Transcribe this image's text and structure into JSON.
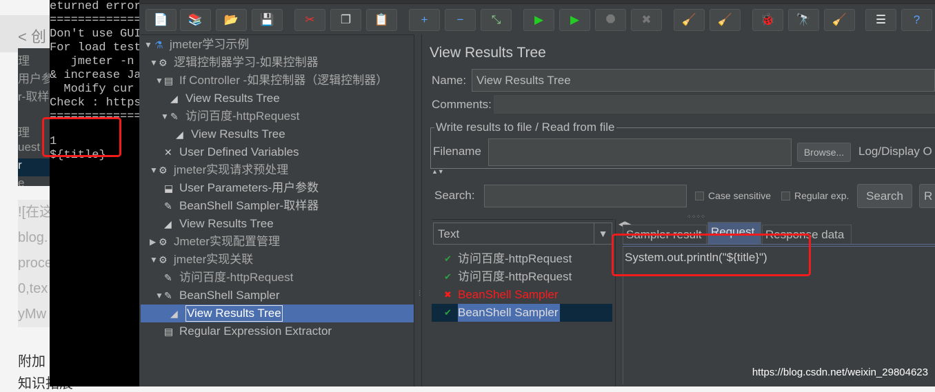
{
  "blog": {
    "back_label": "< 创",
    "shot_lines": [
      "理",
      "用户参",
      "r-取样",
      "",
      "理",
      "uest",
      "r",
      "e"
    ],
    "code_lines": [
      "![在这",
      "blog.",
      "proce",
      "0,tex",
      "yMw"
    ],
    "heading": "附加",
    "next_heading": "知识拓展"
  },
  "terminal": {
    "lines": [
      "eturned error",
      "=============",
      "Don't use GUI",
      "For load test",
      "   jmeter -n ",
      "& increase Ja",
      "  Modify cur",
      "Check : https",
      "=============",
      "1",
      "${title}"
    ]
  },
  "toolbar": {
    "buttons": [
      {
        "name": "new",
        "glyph": "📄",
        "color": "#eee"
      },
      {
        "name": "templates",
        "glyph": "📚",
        "color": "#3a3"
      },
      {
        "name": "open",
        "glyph": "📂",
        "color": "#e8a33a"
      },
      {
        "name": "save",
        "glyph": "💾",
        "color": "#ccc"
      },
      {
        "name": "cut",
        "glyph": "✂",
        "color": "#e33"
      },
      {
        "name": "copy",
        "glyph": "❐",
        "color": "#ddd"
      },
      {
        "name": "paste",
        "glyph": "📋",
        "color": "#d9a"
      },
      {
        "name": "expand",
        "glyph": "+",
        "color": "#5aa0ff"
      },
      {
        "name": "collapse",
        "glyph": "−",
        "color": "#5aa0ff"
      },
      {
        "name": "toggle",
        "glyph": "⤡",
        "color": "#8c8"
      },
      {
        "name": "start",
        "glyph": "▶",
        "color": "#2c2"
      },
      {
        "name": "start-no-pauses",
        "glyph": "▶",
        "color": "#2c2"
      },
      {
        "name": "stop",
        "glyph": "⯃",
        "color": "#777"
      },
      {
        "name": "shutdown",
        "glyph": "✖",
        "color": "#777"
      },
      {
        "name": "clear",
        "glyph": "🧹",
        "color": "#c96"
      },
      {
        "name": "clear-all",
        "glyph": "🧹",
        "color": "#c96"
      },
      {
        "name": "function-helper",
        "glyph": "🐞",
        "color": "#3a3"
      },
      {
        "name": "search",
        "glyph": "🔭",
        "color": "#ccc"
      },
      {
        "name": "reset-search",
        "glyph": "🧹",
        "color": "#fc3"
      },
      {
        "name": "log-viewer",
        "glyph": "☰",
        "color": "#fff"
      },
      {
        "name": "help",
        "glyph": "?",
        "color": "#5aa0ff"
      }
    ]
  },
  "tree": {
    "items": [
      {
        "label": "jmeter学习示例",
        "icon": "flask-icon",
        "glyph": "⚗",
        "arrow": "▼"
      },
      {
        "label": "逻辑控制器学习-如果控制器",
        "icon": "gear-icon",
        "glyph": "⚙",
        "arrow": "▼"
      },
      {
        "label": "If Controller  -如果控制器（逻辑控制器）",
        "icon": "controller-icon",
        "glyph": "▤",
        "arrow": "▼"
      },
      {
        "label": "View Results Tree",
        "icon": "chart-icon",
        "glyph": "◢",
        "arrow": ""
      },
      {
        "label": "访问百度-httpRequest",
        "icon": "pen-icon",
        "glyph": "✎",
        "arrow": "▼"
      },
      {
        "label": "View Results Tree",
        "icon": "chart-icon",
        "glyph": "◢",
        "arrow": ""
      },
      {
        "label": "User Defined Variables",
        "icon": "wrench-icon",
        "glyph": "✕",
        "arrow": ""
      },
      {
        "label": "jmeter实现请求预处理",
        "icon": "gear-icon",
        "glyph": "⚙",
        "arrow": "▼"
      },
      {
        "label": "User Parameters-用户参数",
        "icon": "preprocessor-icon",
        "glyph": "⬓",
        "arrow": ""
      },
      {
        "label": "BeanShell Sampler-取样器",
        "icon": "pen-icon",
        "glyph": "✎",
        "arrow": ""
      },
      {
        "label": "View Results Tree",
        "icon": "chart-icon",
        "glyph": "◢",
        "arrow": ""
      },
      {
        "label": "Jmeter实现配置管理",
        "icon": "gear-icon",
        "glyph": "⚙",
        "arrow": "▶"
      },
      {
        "label": "jmeter实现关联",
        "icon": "gear-icon",
        "glyph": "⚙",
        "arrow": "▼"
      },
      {
        "label": "访问百度-httpRequest",
        "icon": "pen-icon",
        "glyph": "✎",
        "arrow": ""
      },
      {
        "label": "BeanShell Sampler",
        "icon": "pen-icon",
        "glyph": "✎",
        "arrow": "▼"
      },
      {
        "label": "View Results Tree",
        "icon": "chart-icon",
        "glyph": "◢",
        "arrow": "",
        "selected": true
      },
      {
        "label": "Regular Expression Extractor",
        "icon": "extractor-icon",
        "glyph": "▤",
        "arrow": ""
      }
    ]
  },
  "panel": {
    "title": "View Results Tree",
    "name_label": "Name:",
    "name_value": "View Results Tree",
    "comments_label": "Comments:",
    "comments_value": "",
    "file_group_label": "Write results to file / Read from file",
    "filename_label": "Filename",
    "filename_value": "",
    "browse_label": "Browse...",
    "log_display_label": "Log/Display O",
    "search_label": "Search:",
    "search_value": "",
    "case_sensitive_label": "Case sensitive",
    "regular_exp_label": "Regular exp.",
    "search_button": "Search",
    "reset_button": "R",
    "renderer_value": "Text",
    "results": [
      {
        "label": "访问百度-httpRequest",
        "status": "success"
      },
      {
        "label": "访问百度-httpRequest",
        "status": "success"
      },
      {
        "label": "BeanShell Sampler",
        "status": "error"
      },
      {
        "label": "BeanShell Sampler",
        "status": "success",
        "selected": true
      }
    ],
    "tabs": [
      "Sampler result",
      "Request",
      "Response data"
    ],
    "active_tab": "Request",
    "request_text": "System.out.println(\"${title}\")"
  },
  "colors": {
    "success": "#2ea043",
    "error": "#ff1a1a",
    "selection": "#4b6eaf",
    "annotation": "#f21c1c"
  },
  "watermark": "https://blog.csdn.net/weixin_29804623"
}
